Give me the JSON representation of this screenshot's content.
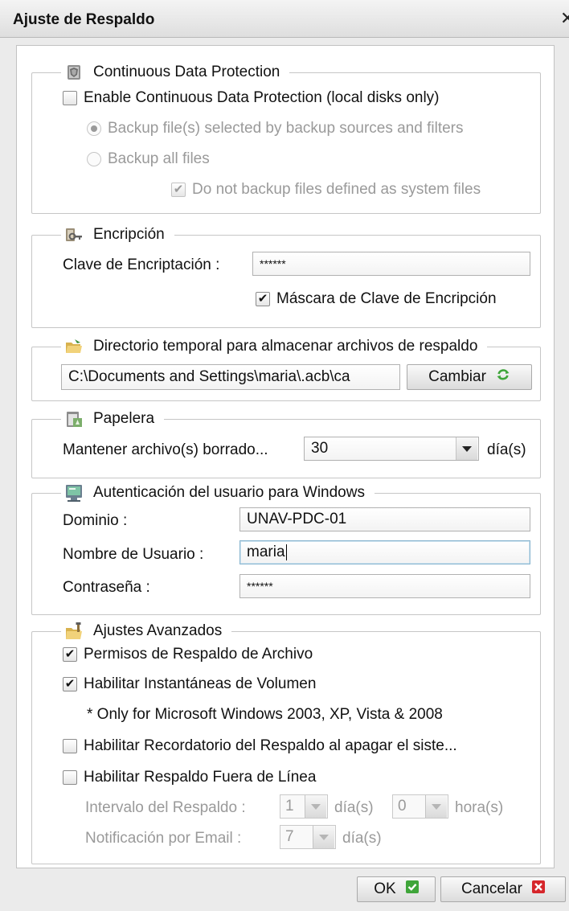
{
  "window": {
    "title": "Ajuste de Respaldo",
    "close_glyph": "✕"
  },
  "cdp": {
    "legend": "Continuous Data Protection",
    "icon": "cdp-shield-icon",
    "enable_label": "Enable Continuous Data Protection (local disks only)",
    "enable_checked": false,
    "option_selected_label": "Backup file(s) selected by backup sources and filters",
    "option_all_label": "Backup all files",
    "system_files_label": "Do not backup files defined as system files",
    "system_files_checked": true
  },
  "encryption": {
    "legend": "Encripción",
    "icon": "key-icon",
    "key_label": "Clave de Encriptación :",
    "key_value": "******",
    "mask_label": "Máscara de Clave de Encripción",
    "mask_checked": true
  },
  "temp_dir": {
    "legend": "Directorio temporal para almacenar archivos de respaldo",
    "icon": "folder-icon",
    "path_value": "C:\\Documents and Settings\\maria\\.acb\\ca",
    "change_label": "Cambiar"
  },
  "recycle": {
    "legend": "Papelera",
    "icon": "recycle-bin-icon",
    "keep_label": "Mantener archivo(s) borrado...",
    "keep_value": "30",
    "unit": "día(s)"
  },
  "windows_auth": {
    "legend": "Autenticación del usuario para Windows",
    "icon": "computer-icon",
    "domain_label": "Dominio :",
    "domain_value": "UNAV-PDC-01",
    "user_label": "Nombre de Usuario :",
    "user_value": "maria",
    "password_label": "Contraseña :",
    "password_value": "******"
  },
  "advanced": {
    "legend": "Ajustes Avanzados",
    "icon": "advanced-settings-icon",
    "file_perms_label": "Permisos de Respaldo de Archivo",
    "file_perms_checked": true,
    "shadow_copy_label": "Habilitar Instantáneas de Volumen",
    "shadow_copy_checked": true,
    "shadow_note": "* Only for Microsoft Windows 2003, XP, Vista & 2008",
    "reminder_label": "Habilitar Recordatorio del Respaldo al apagar el siste...",
    "reminder_checked": false,
    "offline_label": "Habilitar Respaldo Fuera de Línea",
    "offline_checked": false,
    "interval_label": "Intervalo del Respaldo :",
    "interval_days": "1",
    "days_unit": "día(s)",
    "interval_hours": "0",
    "hours_unit": "hora(s)",
    "email_label": "Notificación por Email :",
    "email_days": "7",
    "email_unit": "día(s)"
  },
  "footer": {
    "ok_label": "OK",
    "cancel_label": "Cancelar"
  },
  "colors": {
    "accent_green": "#3fa53a",
    "cancel_red": "#d6262b",
    "focus_blue": "#86b4cf"
  }
}
